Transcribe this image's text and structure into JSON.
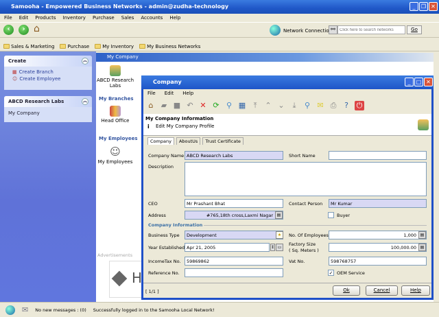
{
  "app": {
    "title": "Samooha - Empowered Business Networks - admin@zudha-technology"
  },
  "menu": [
    "File",
    "Edit",
    "Products",
    "Inventory",
    "Purchase",
    "Sales",
    "Accounts",
    "Help"
  ],
  "toolbar": {
    "network_label": "Network Connection",
    "search_placeholder": "Click here to search networks",
    "go_label": "Go"
  },
  "bookmarks": [
    "Sales & Marketing",
    "Purchase",
    "My Inventory",
    "My Business Networks"
  ],
  "sidebar": {
    "create": {
      "title": "Create",
      "items": [
        "Create Branch",
        "Create Employee"
      ]
    },
    "company": {
      "title": "ABCD Research Labs",
      "items": [
        "My Company"
      ]
    }
  },
  "main": {
    "header": "My Company",
    "company_icon_label": "ABCD Research Labs",
    "branches_title": "My Branches",
    "branch_label": "Head Office",
    "employees_title": "My Employees",
    "employees_label": "My Employees",
    "ads_title": "Advertisements",
    "ad_text": "H"
  },
  "dialog": {
    "title": "Company",
    "menu": [
      "File",
      "Edit",
      "Help"
    ],
    "info_title": "My Company Information",
    "info_subtitle": "Edit My Company Profile",
    "tabs": [
      "Company",
      "AboutUs",
      "Trust Certificate"
    ],
    "fields": {
      "company_name": {
        "label": "Company Name",
        "value": "ABCD Research Labs"
      },
      "short_name": {
        "label": "Short Name",
        "value": ""
      },
      "description": {
        "label": "Description",
        "value": ""
      },
      "ceo": {
        "label": "CEO",
        "value": "Mr Prashant Bhat"
      },
      "contact_person": {
        "label": "Contact Person",
        "value": "Mr Kumar"
      },
      "address": {
        "label": "Address",
        "value": "#765,18th cross,Laxmi Nagar"
      },
      "buyer": {
        "label": "Buyer",
        "checked": false
      },
      "section": "Company Information",
      "business_type": {
        "label": "Business Type",
        "value": "Development"
      },
      "employees": {
        "label": "No. Of Employees",
        "value": "1,000"
      },
      "year": {
        "label": "Year Established",
        "value": "Apr 21, 2005"
      },
      "factory": {
        "label": "Factory Size",
        "label2": "( Sq. Meters )",
        "value": "100,000.00"
      },
      "income_tax": {
        "label": "IncomeTax No.",
        "value": "59869862"
      },
      "vat": {
        "label": "Vat No.",
        "value": "598768757"
      },
      "reference": {
        "label": "Reference No.",
        "value": ""
      },
      "oem": {
        "label": "OEM Service",
        "checked": true
      }
    },
    "pager": "[ 1/1 ]",
    "buttons": {
      "ok": "Ok",
      "cancel": "Cancel",
      "help": "Help"
    }
  },
  "status": {
    "messages": "No new messages : (0)",
    "text": "Successfully logged in to the Samooha Local Network!"
  }
}
